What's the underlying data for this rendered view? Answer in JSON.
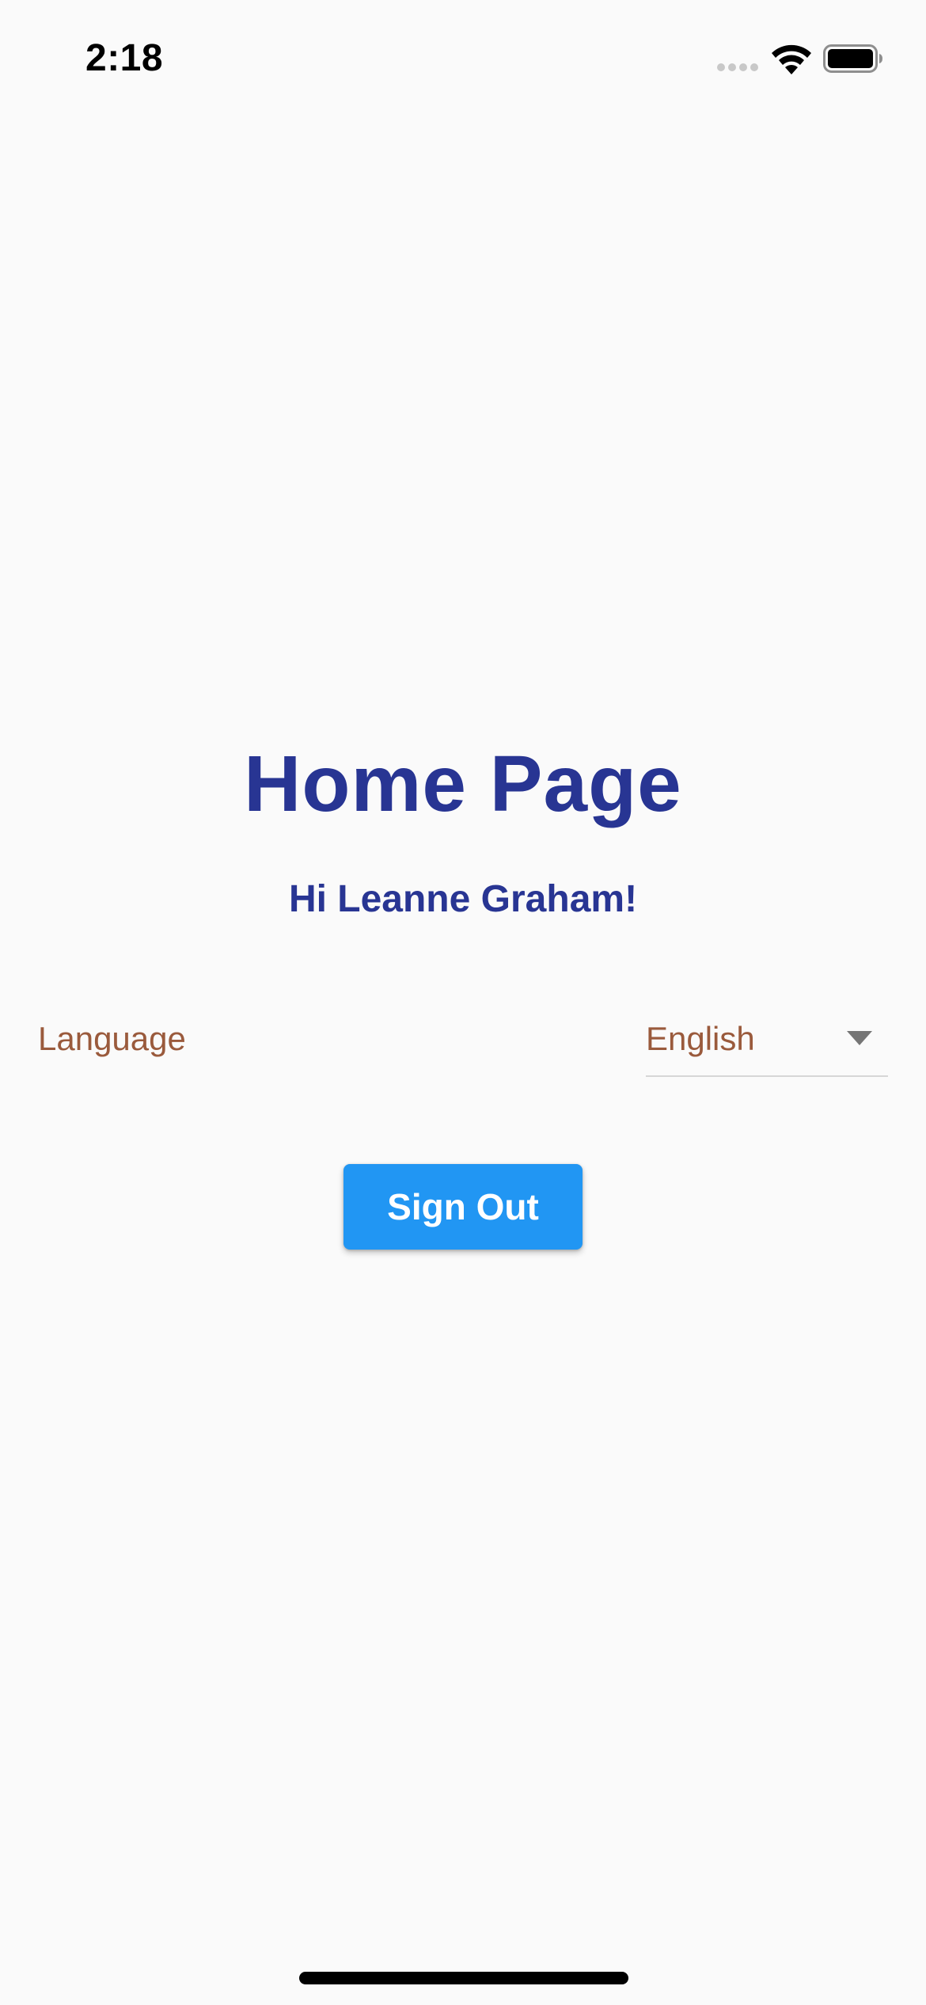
{
  "status_bar": {
    "time": "2:18",
    "icons": [
      "cellular-signal-icon",
      "wifi-icon",
      "battery-icon"
    ]
  },
  "main": {
    "title": "Home Page",
    "greeting": "Hi Leanne Graham!",
    "language": {
      "label": "Language",
      "selected": "English",
      "icon": "dropdown-arrow-icon"
    },
    "sign_out_label": "Sign Out"
  },
  "colors": {
    "background": "#fafafa",
    "title": "#283593",
    "language_text": "#9a5a3c",
    "button": "#2196f3",
    "button_text": "#ffffff"
  }
}
